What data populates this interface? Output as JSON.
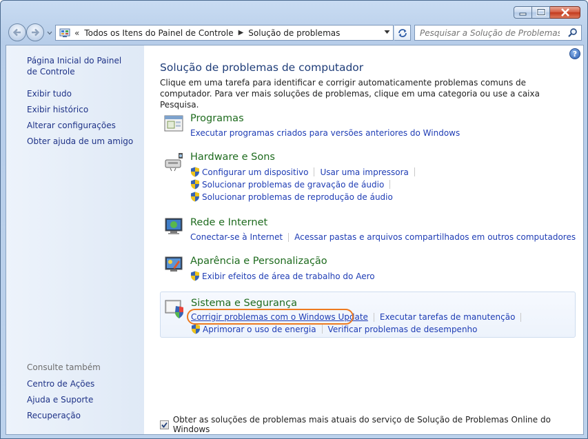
{
  "address": {
    "prefix": "«",
    "crumbs": [
      "Todos os Itens do Painel de Controle",
      "Solução de problemas"
    ]
  },
  "search": {
    "placeholder": "Pesquisar a Solução de Problemas"
  },
  "sidebar": {
    "links": [
      "Página Inicial do Painel de Controle",
      "Exibir tudo",
      "Exibir histórico",
      "Alterar configurações",
      "Obter ajuda de um amigo"
    ],
    "see_also_heading": "Consulte também",
    "see_also": [
      "Centro de Ações",
      "Ajuda e Suporte",
      "Recuperação"
    ]
  },
  "main": {
    "title": "Solução de problemas de computador",
    "intro": "Clique em uma tarefa para identificar e corrigir automaticamente problemas comuns de computador. Para ver mais soluções de problemas, clique em uma categoria ou use a caixa Pesquisa.",
    "categories": [
      {
        "title": "Programas",
        "lines": [
          [
            "Executar programas criados para versões anteriores do Windows"
          ]
        ]
      },
      {
        "title": "Hardware e Sons",
        "lines": [
          [
            "Configurar um dispositivo",
            "Usar uma impressora"
          ],
          [
            "Solucionar problemas de gravação de áudio"
          ],
          [
            "Solucionar problemas de reprodução de áudio"
          ]
        ]
      },
      {
        "title": "Rede e Internet",
        "lines": [
          [
            "Conectar-se à Internet",
            "Acessar pastas e arquivos compartilhados em outros computadores"
          ]
        ]
      },
      {
        "title": "Aparência e Personalização",
        "lines": [
          [
            "Exibir efeitos de área de trabalho do Aero"
          ]
        ]
      },
      {
        "title": "Sistema e Segurança",
        "lines": [
          [
            "Corrigir problemas com o Windows Update",
            "Executar tarefas de manutenção"
          ],
          [
            "Aprimorar o uso de energia",
            "Verificar problemas de desempenho"
          ]
        ]
      }
    ],
    "footer_checkbox": "Obter as soluções de problemas mais atuais do serviço de Solução de Problemas Online do Windows",
    "footer_checked": true
  },
  "colors": {
    "link": "#1e3cb4",
    "category_title": "#1e6b1e",
    "highlight": "#ed7a1f"
  }
}
